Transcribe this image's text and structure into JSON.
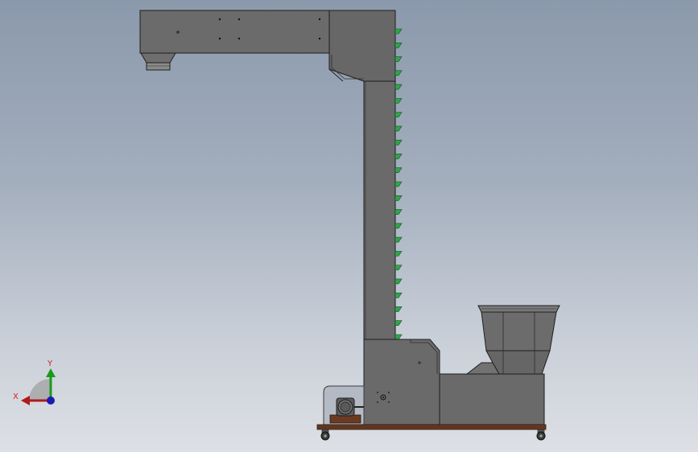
{
  "viewport": {
    "model": "bucket-elevator",
    "background_top": "#8b99ac",
    "background_bottom": "#dde0e5"
  },
  "triad": {
    "x_label": "X",
    "y_label": "Y",
    "x_color": "#b01a1a",
    "y_color": "#1a9a1a",
    "z_color": "#1a1ab0"
  },
  "colors": {
    "body": "#6a6a6a",
    "edge": "#1e1e1e",
    "bucket": "#2fa64a",
    "base": "#6b3a22"
  },
  "bucket_count": 23
}
